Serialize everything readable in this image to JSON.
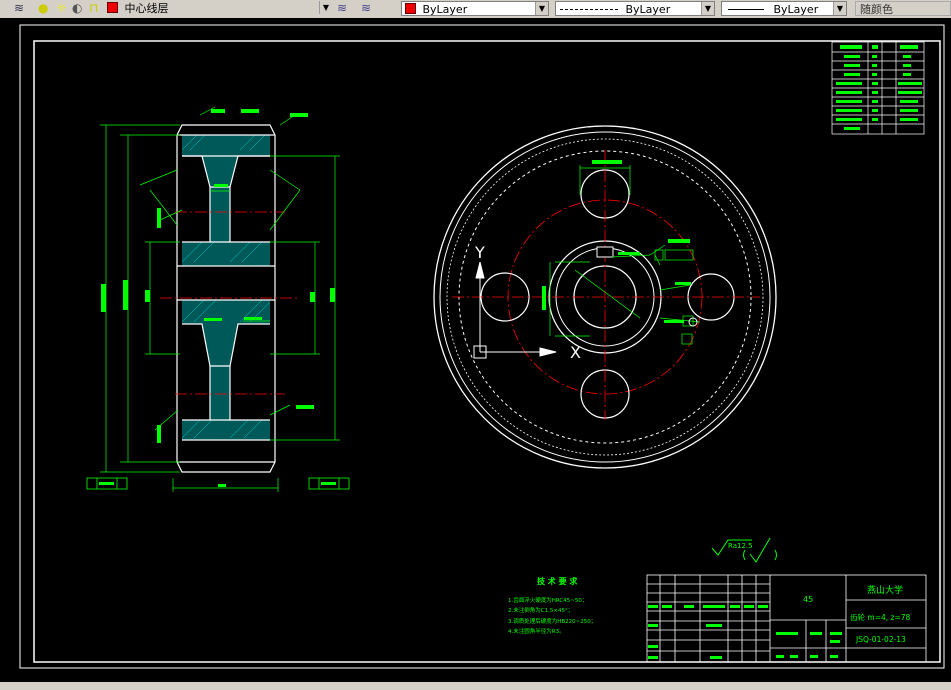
{
  "toolbar": {
    "layer_name": "中心线层",
    "color_label": "ByLayer",
    "linetype_label": "ByLayer",
    "lineweight_label": "ByLayer",
    "plotstyle_label": "随颜色",
    "layer_color": "#ff0000"
  },
  "drawing": {
    "material": "45",
    "university": "燕山大学",
    "part_name": "齿轮 m=4, z=78",
    "drawing_no": "JSQ-01-02-13",
    "tech_title": "技 术 要 求",
    "tech_notes": [
      "1.齿面淬火硬度为HRC45~50；",
      "2.未注倒角为C1.5×45°；",
      "3.调质处理后硬度为HB220~250；",
      "4.未注圆角半径为R3。"
    ],
    "surface_roughness": "Ra12.5",
    "axis_y": "Y",
    "axis_x": "X",
    "lines_color": "#ffffff",
    "dim_color": "#00ff00",
    "center_color": "#ff0000"
  }
}
